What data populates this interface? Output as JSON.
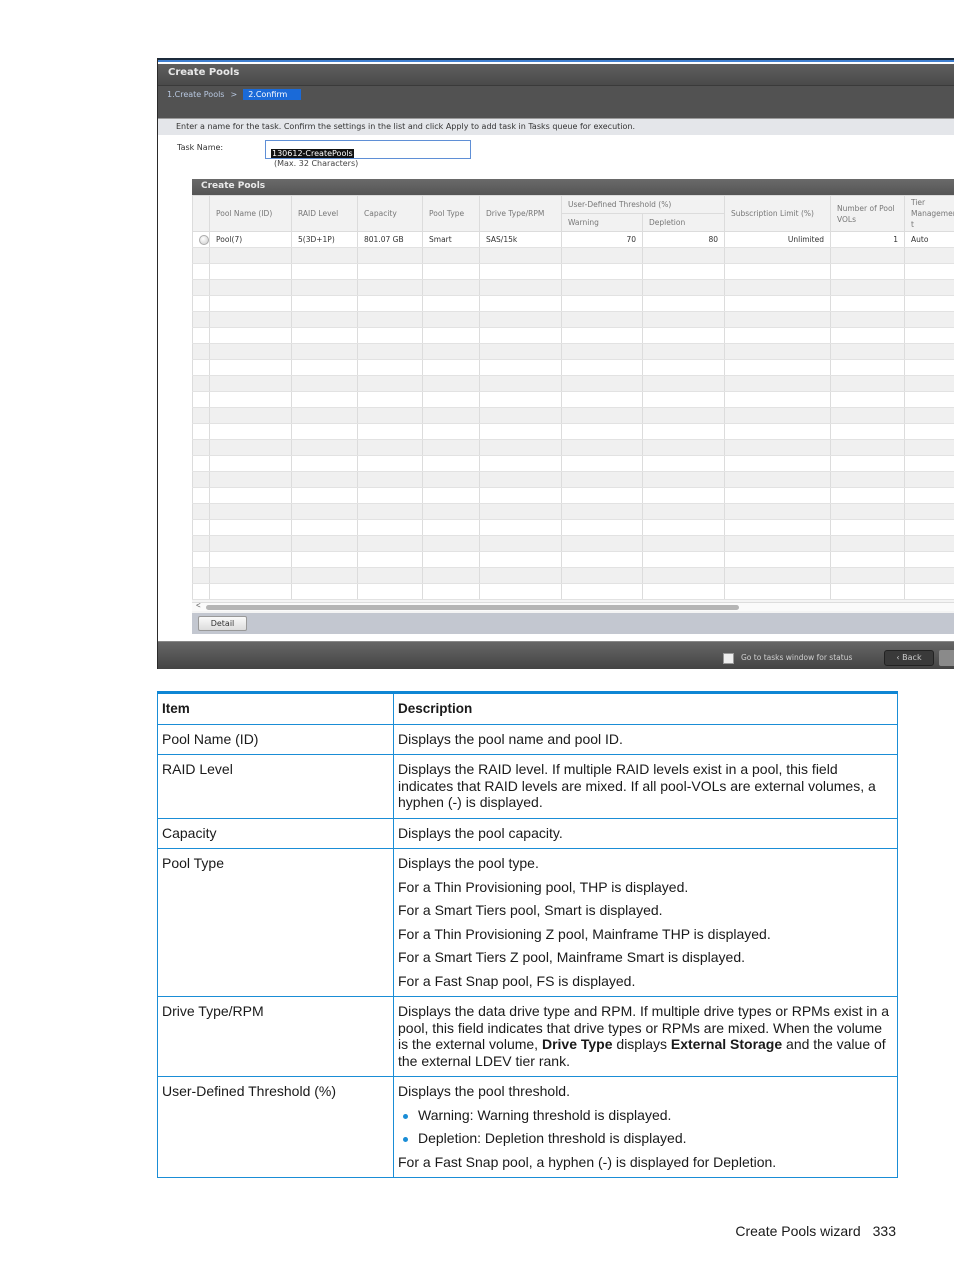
{
  "screenshot": {
    "window_title": "Create Pools",
    "steps": [
      {
        "label": "1.Create Pools",
        "active": false
      },
      {
        "label": "2.Confirm",
        "active": true
      }
    ],
    "step_separator": ">",
    "instruction": "Enter a name for the task. Confirm the settings in the list and click Apply to add task in Tasks queue for execution.",
    "task_name": {
      "label": "Task Name:",
      "value": "130612-CreatePools",
      "hint": "(Max. 32 Characters)"
    },
    "panel_title": "Create Pools",
    "grid": {
      "headers": {
        "pool_name": "Pool Name (ID)",
        "raid_level": "RAID Level",
        "capacity": "Capacity",
        "pool_type": "Pool Type",
        "drive_type": "Drive Type/RPM",
        "threshold_group": "User-Defined Threshold (%)",
        "warning": "Warning",
        "depletion": "Depletion",
        "subscription": "Subscription Limit (%)",
        "pool_vols": "Number of Pool VOLs",
        "tier_mgmt": "Tier Managemen t"
      },
      "rows": [
        {
          "pool_name": "Pool(7)",
          "raid_level": "5(3D+1P)",
          "capacity": "801.07 GB",
          "pool_type": "Smart",
          "drive_type": "SAS/15k",
          "warning": "70",
          "depletion": "80",
          "subscription": "Unlimited",
          "pool_vols": "1",
          "tier_mgmt": "Auto"
        }
      ],
      "empty_row_count": 22
    },
    "scroll_left_arrow": "<",
    "detail_button": "Detail",
    "go_to_tasks_label": "Go to tasks window for status",
    "go_to_tasks_checked": false,
    "back_button": "Back"
  },
  "doc_table": {
    "headers": {
      "item": "Item",
      "description": "Description"
    },
    "rows": [
      {
        "item": "Pool Name (ID)",
        "paras": [
          "Displays the pool name and pool ID."
        ]
      },
      {
        "item": "RAID Level",
        "paras": [
          "Displays the RAID level. If multiple RAID levels exist in a pool, this field indicates that RAID levels are mixed. If all pool-VOLs are external volumes, a hyphen (-) is displayed."
        ]
      },
      {
        "item": "Capacity",
        "paras": [
          "Displays the pool capacity."
        ]
      },
      {
        "item": "Pool Type",
        "paras": [
          "Displays the pool type.",
          "For a Thin Provisioning pool, THP is displayed.",
          "For a Smart Tiers pool, Smart is displayed.",
          "For a Thin Provisioning Z pool, Mainframe THP is displayed.",
          "For a Smart Tiers Z pool, Mainframe Smart is displayed.",
          "For a Fast Snap pool, FS is displayed."
        ]
      },
      {
        "item": "Drive Type/RPM",
        "desc_part1": "Displays the data drive type and RPM. If multiple drive types or RPMs exist in a pool, this field indicates that drive types or RPMs are mixed. When the volume is the external volume, ",
        "bold1": "Drive Type",
        "desc_part2": " displays ",
        "bold2": "External Storage",
        "desc_part3": " and the value of the external LDEV tier rank."
      },
      {
        "item": "User-Defined Threshold (%)",
        "intro": "Displays the pool threshold.",
        "bullets": [
          "Warning: Warning threshold is displayed.",
          "Depletion: Depletion threshold is displayed."
        ],
        "outro": "For a Fast Snap pool, a hyphen (-) is displayed for Depletion."
      }
    ]
  },
  "footer": {
    "section": "Create Pools wizard",
    "page_number": "333"
  }
}
